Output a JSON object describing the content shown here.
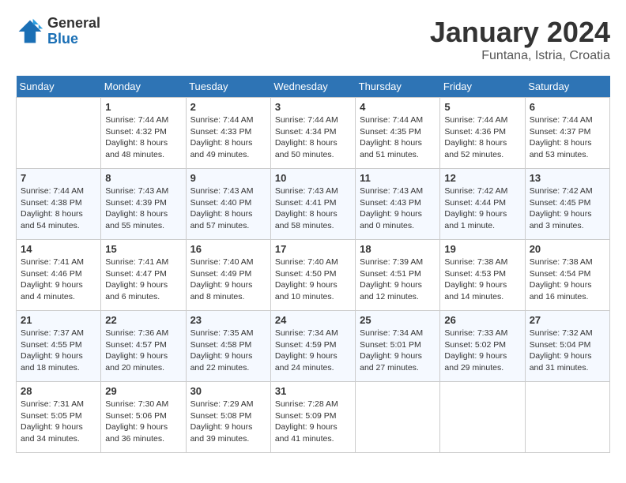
{
  "header": {
    "logo_general": "General",
    "logo_blue": "Blue",
    "month_title": "January 2024",
    "location": "Funtana, Istria, Croatia"
  },
  "days_of_week": [
    "Sunday",
    "Monday",
    "Tuesday",
    "Wednesday",
    "Thursday",
    "Friday",
    "Saturday"
  ],
  "weeks": [
    [
      {
        "day": "",
        "sunrise": "",
        "sunset": "",
        "daylight": ""
      },
      {
        "day": "1",
        "sunrise": "Sunrise: 7:44 AM",
        "sunset": "Sunset: 4:32 PM",
        "daylight": "Daylight: 8 hours and 48 minutes."
      },
      {
        "day": "2",
        "sunrise": "Sunrise: 7:44 AM",
        "sunset": "Sunset: 4:33 PM",
        "daylight": "Daylight: 8 hours and 49 minutes."
      },
      {
        "day": "3",
        "sunrise": "Sunrise: 7:44 AM",
        "sunset": "Sunset: 4:34 PM",
        "daylight": "Daylight: 8 hours and 50 minutes."
      },
      {
        "day": "4",
        "sunrise": "Sunrise: 7:44 AM",
        "sunset": "Sunset: 4:35 PM",
        "daylight": "Daylight: 8 hours and 51 minutes."
      },
      {
        "day": "5",
        "sunrise": "Sunrise: 7:44 AM",
        "sunset": "Sunset: 4:36 PM",
        "daylight": "Daylight: 8 hours and 52 minutes."
      },
      {
        "day": "6",
        "sunrise": "Sunrise: 7:44 AM",
        "sunset": "Sunset: 4:37 PM",
        "daylight": "Daylight: 8 hours and 53 minutes."
      }
    ],
    [
      {
        "day": "7",
        "sunrise": "Sunrise: 7:44 AM",
        "sunset": "Sunset: 4:38 PM",
        "daylight": "Daylight: 8 hours and 54 minutes."
      },
      {
        "day": "8",
        "sunrise": "Sunrise: 7:43 AM",
        "sunset": "Sunset: 4:39 PM",
        "daylight": "Daylight: 8 hours and 55 minutes."
      },
      {
        "day": "9",
        "sunrise": "Sunrise: 7:43 AM",
        "sunset": "Sunset: 4:40 PM",
        "daylight": "Daylight: 8 hours and 57 minutes."
      },
      {
        "day": "10",
        "sunrise": "Sunrise: 7:43 AM",
        "sunset": "Sunset: 4:41 PM",
        "daylight": "Daylight: 8 hours and 58 minutes."
      },
      {
        "day": "11",
        "sunrise": "Sunrise: 7:43 AM",
        "sunset": "Sunset: 4:43 PM",
        "daylight": "Daylight: 9 hours and 0 minutes."
      },
      {
        "day": "12",
        "sunrise": "Sunrise: 7:42 AM",
        "sunset": "Sunset: 4:44 PM",
        "daylight": "Daylight: 9 hours and 1 minute."
      },
      {
        "day": "13",
        "sunrise": "Sunrise: 7:42 AM",
        "sunset": "Sunset: 4:45 PM",
        "daylight": "Daylight: 9 hours and 3 minutes."
      }
    ],
    [
      {
        "day": "14",
        "sunrise": "Sunrise: 7:41 AM",
        "sunset": "Sunset: 4:46 PM",
        "daylight": "Daylight: 9 hours and 4 minutes."
      },
      {
        "day": "15",
        "sunrise": "Sunrise: 7:41 AM",
        "sunset": "Sunset: 4:47 PM",
        "daylight": "Daylight: 9 hours and 6 minutes."
      },
      {
        "day": "16",
        "sunrise": "Sunrise: 7:40 AM",
        "sunset": "Sunset: 4:49 PM",
        "daylight": "Daylight: 9 hours and 8 minutes."
      },
      {
        "day": "17",
        "sunrise": "Sunrise: 7:40 AM",
        "sunset": "Sunset: 4:50 PM",
        "daylight": "Daylight: 9 hours and 10 minutes."
      },
      {
        "day": "18",
        "sunrise": "Sunrise: 7:39 AM",
        "sunset": "Sunset: 4:51 PM",
        "daylight": "Daylight: 9 hours and 12 minutes."
      },
      {
        "day": "19",
        "sunrise": "Sunrise: 7:38 AM",
        "sunset": "Sunset: 4:53 PM",
        "daylight": "Daylight: 9 hours and 14 minutes."
      },
      {
        "day": "20",
        "sunrise": "Sunrise: 7:38 AM",
        "sunset": "Sunset: 4:54 PM",
        "daylight": "Daylight: 9 hours and 16 minutes."
      }
    ],
    [
      {
        "day": "21",
        "sunrise": "Sunrise: 7:37 AM",
        "sunset": "Sunset: 4:55 PM",
        "daylight": "Daylight: 9 hours and 18 minutes."
      },
      {
        "day": "22",
        "sunrise": "Sunrise: 7:36 AM",
        "sunset": "Sunset: 4:57 PM",
        "daylight": "Daylight: 9 hours and 20 minutes."
      },
      {
        "day": "23",
        "sunrise": "Sunrise: 7:35 AM",
        "sunset": "Sunset: 4:58 PM",
        "daylight": "Daylight: 9 hours and 22 minutes."
      },
      {
        "day": "24",
        "sunrise": "Sunrise: 7:34 AM",
        "sunset": "Sunset: 4:59 PM",
        "daylight": "Daylight: 9 hours and 24 minutes."
      },
      {
        "day": "25",
        "sunrise": "Sunrise: 7:34 AM",
        "sunset": "Sunset: 5:01 PM",
        "daylight": "Daylight: 9 hours and 27 minutes."
      },
      {
        "day": "26",
        "sunrise": "Sunrise: 7:33 AM",
        "sunset": "Sunset: 5:02 PM",
        "daylight": "Daylight: 9 hours and 29 minutes."
      },
      {
        "day": "27",
        "sunrise": "Sunrise: 7:32 AM",
        "sunset": "Sunset: 5:04 PM",
        "daylight": "Daylight: 9 hours and 31 minutes."
      }
    ],
    [
      {
        "day": "28",
        "sunrise": "Sunrise: 7:31 AM",
        "sunset": "Sunset: 5:05 PM",
        "daylight": "Daylight: 9 hours and 34 minutes."
      },
      {
        "day": "29",
        "sunrise": "Sunrise: 7:30 AM",
        "sunset": "Sunset: 5:06 PM",
        "daylight": "Daylight: 9 hours and 36 minutes."
      },
      {
        "day": "30",
        "sunrise": "Sunrise: 7:29 AM",
        "sunset": "Sunset: 5:08 PM",
        "daylight": "Daylight: 9 hours and 39 minutes."
      },
      {
        "day": "31",
        "sunrise": "Sunrise: 7:28 AM",
        "sunset": "Sunset: 5:09 PM",
        "daylight": "Daylight: 9 hours and 41 minutes."
      },
      {
        "day": "",
        "sunrise": "",
        "sunset": "",
        "daylight": ""
      },
      {
        "day": "",
        "sunrise": "",
        "sunset": "",
        "daylight": ""
      },
      {
        "day": "",
        "sunrise": "",
        "sunset": "",
        "daylight": ""
      }
    ]
  ]
}
